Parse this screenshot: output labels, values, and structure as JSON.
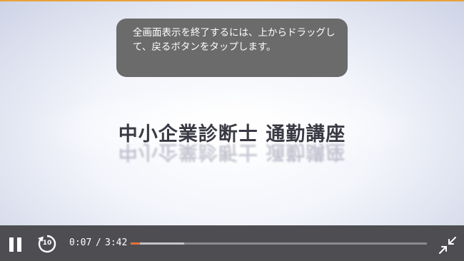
{
  "video": {
    "title": "中小企業診断士 通勤講座"
  },
  "toast": {
    "message": "全画面表示を終了するには、上からドラッグして、戻るボタンをタップします。"
  },
  "player": {
    "current_time": "0:07",
    "separator": "/",
    "duration": "3:42",
    "replay_seconds": "10",
    "progress_fraction": 0.0315,
    "buffered_fraction": 0.18,
    "controls": {
      "play_pause_icon": "pause-icon",
      "replay_icon": "replay-10-icon",
      "fullscreen_icon": "exit-fullscreen-icon"
    },
    "colors": {
      "progress": "#e8713a",
      "control_bar": "#4e4e52"
    }
  }
}
